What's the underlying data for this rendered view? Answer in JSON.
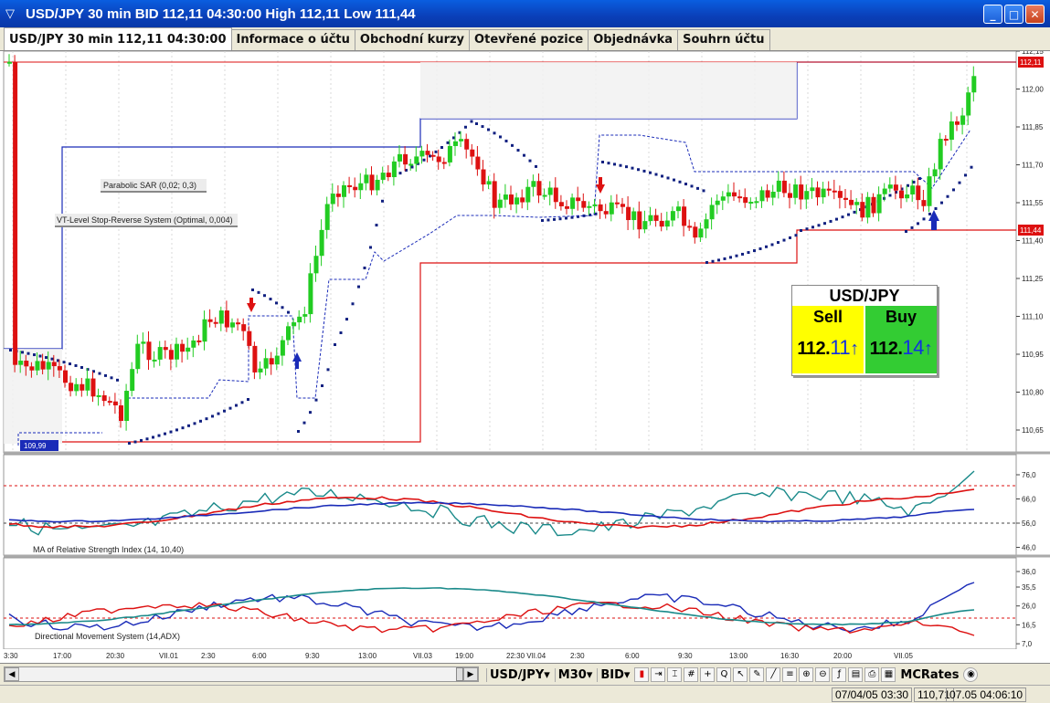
{
  "window": {
    "title": "USD/JPY 30 min BID 112,11 04:30:00 High 112,11 Low 111,44",
    "minimize": "_",
    "maximize": "□",
    "close": "✕"
  },
  "tabs": [
    {
      "label": "USD/JPY 30 min 112,11 04:30:00",
      "active": true
    },
    {
      "label": "Informace o účtu"
    },
    {
      "label": "Obchodní kurzy"
    },
    {
      "label": "Otevřené pozice"
    },
    {
      "label": "Objednávka"
    },
    {
      "label": "Souhrn účtu"
    }
  ],
  "main_chart": {
    "indicator_labels": {
      "sar": "Parabolic SAR (0,02; 0,3)",
      "vt": "VT-Level Stop-Reverse System (Optimal, 0,004)"
    },
    "y_ticks": [
      "112,15",
      "112,00",
      "111,85",
      "111,70",
      "111,55",
      "111,40",
      "111,25",
      "111,10",
      "110,95",
      "110,80",
      "110,65"
    ],
    "last_price_tag": "112,11",
    "low_tag": "111,44",
    "left_tag": "109,99",
    "colors": {
      "up": "#22cc22",
      "down": "#dd1111",
      "sar": "#102080",
      "stop_blue": "#1a2bb8",
      "stop_red": "#dd1111"
    }
  },
  "quote_panel": {
    "symbol": "USD/JPY",
    "sell_label": "Sell",
    "buy_label": "Buy",
    "sell_prefix": "112.",
    "sell_pips": "11",
    "buy_prefix": "112.",
    "buy_pips": "14",
    "arrow": "↑"
  },
  "rsi_panel": {
    "label": "MA of Relative Strength Index (14, 10,40)",
    "y_ticks": [
      "76,0",
      "66,0",
      "56,0",
      "46,0",
      "36,0"
    ]
  },
  "dms_panel": {
    "label": "Directional Movement System (14,ADX)",
    "y_ticks": [
      "35,5",
      "26,0",
      "16,5",
      "7,0"
    ]
  },
  "x_axis": [
    "3:30",
    "17:00",
    "20:30",
    "VII.01",
    "2:30",
    "6:00",
    "9:30",
    "13:00",
    "VII.03",
    "19:00",
    "22:30 VII.04",
    "2:30",
    "6:00",
    "9:30",
    "13:00",
    "16:30",
    "20:00",
    "VII.05"
  ],
  "toolbar": {
    "symbol": "USD/JPY",
    "timeframe": "M30",
    "price_type": "BID",
    "brand": "MCRates"
  },
  "status": {
    "cursor": "07/04/05 03:30",
    "cursor_price": "110,71",
    "server_time": "07.05 04:06:10"
  }
}
